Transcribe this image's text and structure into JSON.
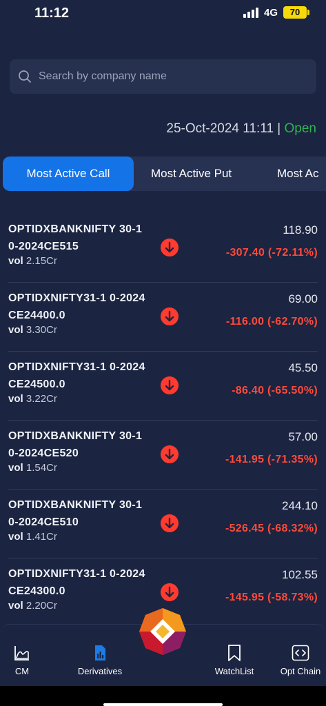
{
  "status_bar": {
    "time": "11:12",
    "network": "4G",
    "battery": "70"
  },
  "search": {
    "placeholder": "Search by company name"
  },
  "market": {
    "datetime": "25-Oct-2024 11:11 |",
    "status": "Open"
  },
  "tabs": [
    {
      "label": "Most Active Call",
      "active": true
    },
    {
      "label": "Most Active Put",
      "active": false
    },
    {
      "label": "Most Ac",
      "active": false
    }
  ],
  "rows": [
    {
      "name": "OPTIDXBANKNIFTY 30-10-2024CE515",
      "vol_label": "vol",
      "vol": "2.15Cr",
      "price": "118.90",
      "change": "-307.40 (-72.11%)"
    },
    {
      "name": "OPTIDXNIFTY31-1 0-2024CE24400.0",
      "vol_label": "vol",
      "vol": "3.30Cr",
      "price": "69.00",
      "change": "-116.00 (-62.70%)"
    },
    {
      "name": "OPTIDXNIFTY31-1 0-2024CE24500.0",
      "vol_label": "vol",
      "vol": "3.22Cr",
      "price": "45.50",
      "change": "-86.40 (-65.50%)"
    },
    {
      "name": "OPTIDXBANKNIFTY 30-10-2024CE520",
      "vol_label": "vol",
      "vol": "1.54Cr",
      "price": "57.00",
      "change": "-141.95 (-71.35%)"
    },
    {
      "name": "OPTIDXBANKNIFTY 30-10-2024CE510",
      "vol_label": "vol",
      "vol": "1.41Cr",
      "price": "244.10",
      "change": "-526.45 (-68.32%)"
    },
    {
      "name": "OPTIDXNIFTY31-1 0-2024CE24300.0",
      "vol_label": "vol",
      "vol": "2.20Cr",
      "price": "102.55",
      "change": "-145.95 (-58.73%)"
    }
  ],
  "bottom_nav": [
    {
      "label": "CM",
      "icon": "chart-area-icon"
    },
    {
      "label": "Derivatives",
      "icon": "derivatives-icon",
      "active": true
    },
    {
      "label": "WatchList",
      "icon": "bookmark-icon"
    },
    {
      "label": "Opt Chain",
      "icon": "code-icon"
    }
  ],
  "colors": {
    "accent": "#1473e6",
    "negative": "#ff4a3b",
    "positive": "#2fb44f",
    "background": "#1b2440"
  }
}
